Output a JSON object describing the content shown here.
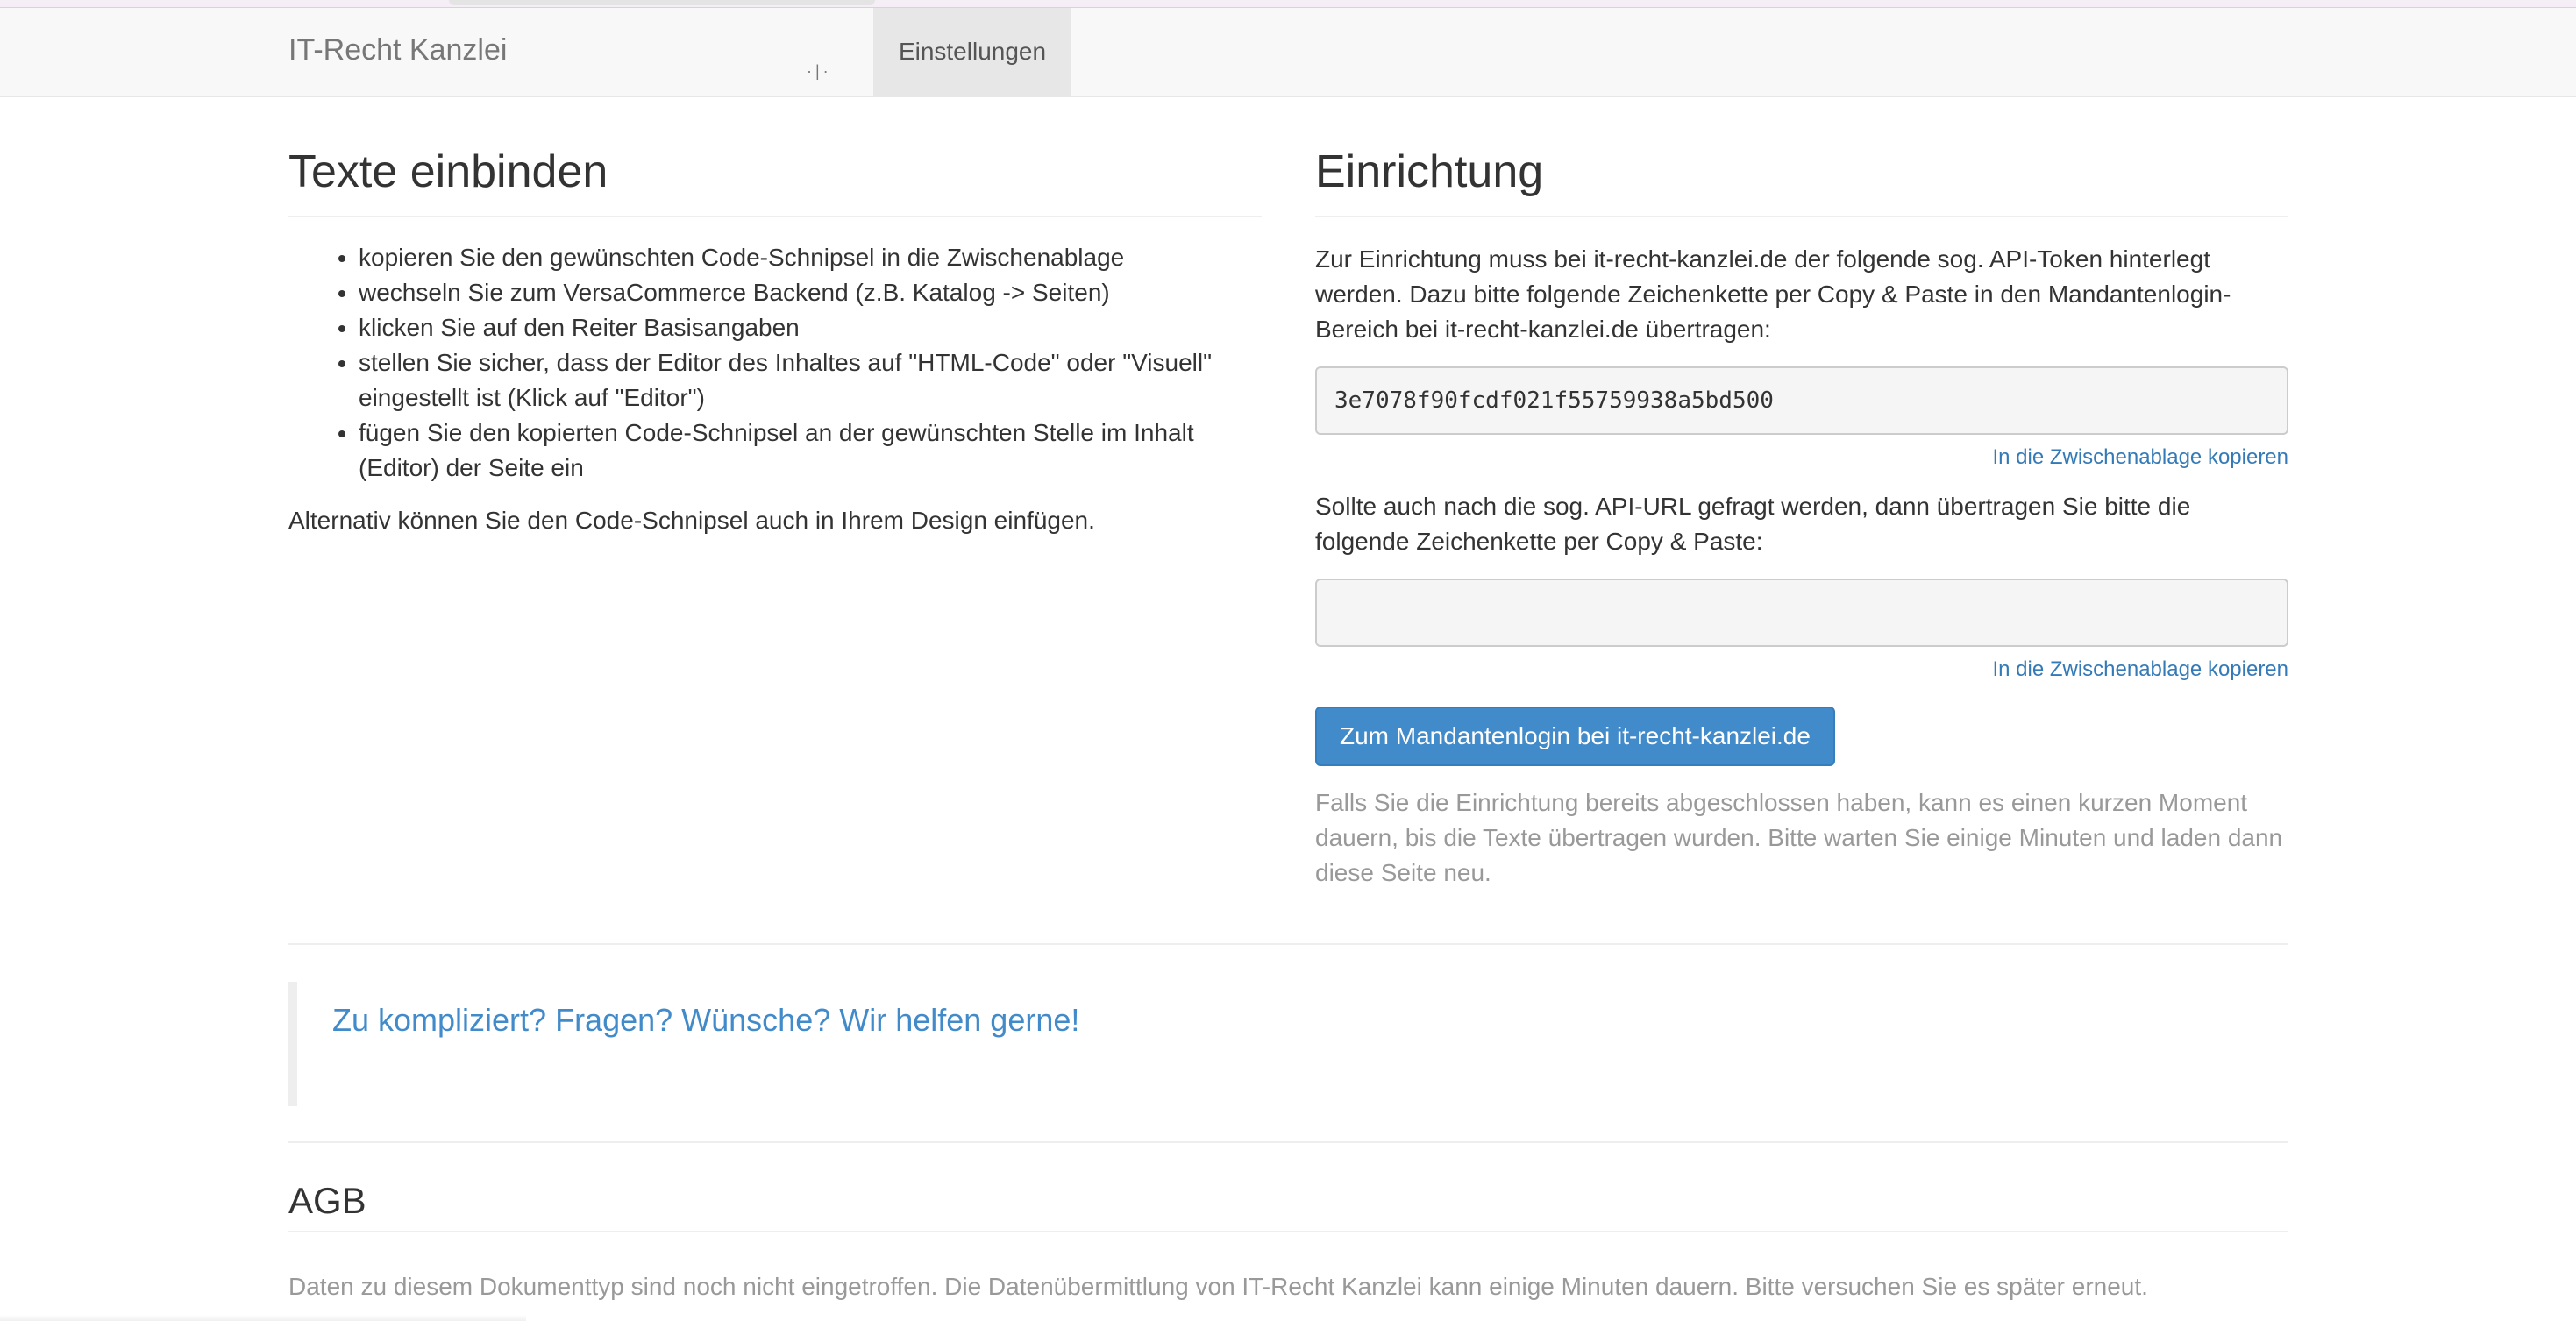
{
  "navbar": {
    "brand": "IT-Recht Kanzlei",
    "mark": "·|·",
    "active_item": "Einstellungen"
  },
  "left": {
    "heading": "Texte einbinden",
    "steps": [
      "kopieren Sie den gewünschten Code-Schnipsel in die Zwischenablage",
      "wechseln Sie zum VersaCommerce Backend (z.B. Katalog -> Seiten)",
      "klicken Sie auf den Reiter Basisangaben",
      "stellen Sie sicher, dass der Editor des Inhaltes auf \"HTML-Code\" oder \"Visuell\" eingestellt ist (Klick auf \"Editor\")",
      "fügen Sie den kopierten Code-Schnipsel an der gewünschten Stelle im Inhalt (Editor) der Seite ein"
    ],
    "alternative": "Alternativ können Sie den Code-Schnipsel auch in Ihrem Design einfügen."
  },
  "right": {
    "heading": "Einrichtung",
    "intro": "Zur Einrichtung muss bei it-recht-kanzlei.de der folgende sog. API-Token hinterlegt werden. Dazu bitte folgende Zeichenkette per Copy & Paste in den Mandantenlogin-Bereich bei it-recht-kanzlei.de übertragen:",
    "token": "3e7078f90fcdf021f55759938a5bd500",
    "copy_link_1": "In die Zwischenablage kopieren",
    "url_question": "Sollte auch nach die sog. API-URL gefragt werden, dann übertragen Sie bitte die folgende Zeichenkette per Copy & Paste:",
    "api_url": "",
    "copy_link_2": "In die Zwischenablage kopieren",
    "login_button": "Zum Mandantenlogin bei it-recht-kanzlei.de",
    "hint": "Falls Sie die Einrichtung bereits abgeschlossen haben, kann es einen kurzen Moment dauern, bis die Texte übertragen wurden. Bitte warten Sie einige Minuten und laden dann diese Seite neu."
  },
  "callout": {
    "text": "Zu kompliziert? Fragen? Wünsche? Wir helfen gerne!"
  },
  "agb": {
    "heading": "AGB",
    "text": "Daten zu diesem Dokumenttyp sind noch nicht eingetroffen. Die Datenübermittlung von IT-Recht Kanzlei kann einige Minuten dauern. Bitte versuchen Sie es später erneut."
  },
  "colors": {
    "link": "#337ab7",
    "button": "#428bca",
    "muted": "#999999"
  }
}
